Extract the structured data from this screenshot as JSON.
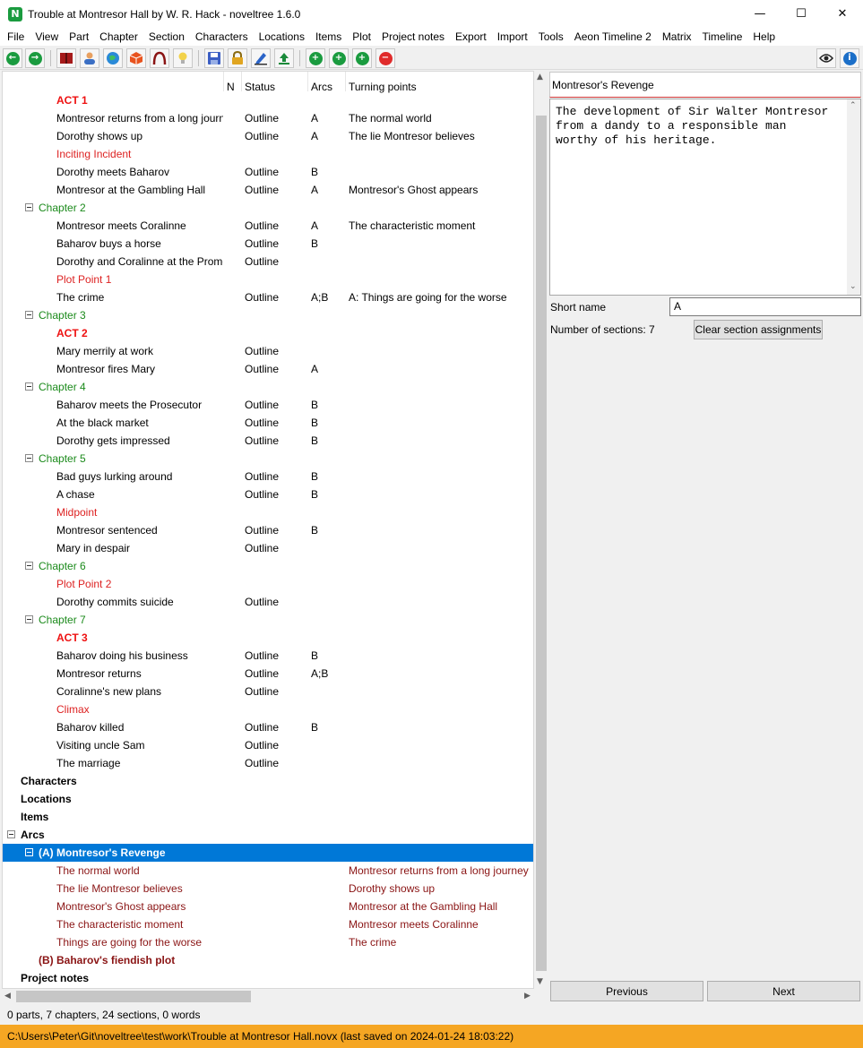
{
  "window": {
    "title": "Trouble at Montresor Hall by W. R. Hack - noveltree 1.6.0",
    "logo_letter": "N",
    "minimize": "—",
    "maximize": "☐",
    "close": "✕"
  },
  "menu": [
    "File",
    "View",
    "Part",
    "Chapter",
    "Section",
    "Characters",
    "Locations",
    "Items",
    "Plot",
    "Project notes",
    "Export",
    "Import",
    "Tools",
    "Aeon Timeline 2",
    "Matrix",
    "Timeline",
    "Help"
  ],
  "toolbar": {
    "icons": [
      "back-icon",
      "forward-icon",
      "book-icon",
      "characters-icon",
      "locations-icon",
      "items-icon",
      "arcs-icon",
      "notes-icon",
      "save-icon",
      "lock-icon",
      "edit-icon",
      "export-icon",
      "add-icon",
      "add-child-icon",
      "add-parent-icon",
      "delete-icon",
      "view-icon",
      "about-icon"
    ],
    "colors": {
      "green": "#1a9b3f",
      "red": "#e02b2b",
      "blue": "#1c6fc8"
    }
  },
  "tree": {
    "columns": {
      "n": "N",
      "status": "Status",
      "arcs": "Arcs",
      "turning_points": "Turning points"
    },
    "rows": [
      {
        "level": 3,
        "type": "stage-major",
        "title": "ACT 1",
        "status": "",
        "arcs": "",
        "tp": ""
      },
      {
        "level": 3,
        "type": "section",
        "title": "Montresor returns from a long journey",
        "status": "Outline",
        "arcs": "A",
        "tp": "The normal world"
      },
      {
        "level": 3,
        "type": "section",
        "title": "Dorothy shows up",
        "status": "Outline",
        "arcs": "A",
        "tp": "The lie Montresor believes"
      },
      {
        "level": 3,
        "type": "stage-minor",
        "title": "Inciting Incident",
        "status": "",
        "arcs": "",
        "tp": ""
      },
      {
        "level": 3,
        "type": "section",
        "title": "Dorothy meets Baharov",
        "status": "Outline",
        "arcs": "B",
        "tp": ""
      },
      {
        "level": 3,
        "type": "section",
        "title": "Montresor at the Gambling Hall",
        "status": "Outline",
        "arcs": "A",
        "tp": "Montresor's Ghost appears"
      },
      {
        "level": 2,
        "type": "chapter",
        "title": "Chapter 2",
        "status": "",
        "arcs": "",
        "tp": ""
      },
      {
        "level": 3,
        "type": "section",
        "title": "Montresor meets Coralinne",
        "status": "Outline",
        "arcs": "A",
        "tp": "The characteristic moment"
      },
      {
        "level": 3,
        "type": "section",
        "title": "Baharov buys a horse",
        "status": "Outline",
        "arcs": "B",
        "tp": ""
      },
      {
        "level": 3,
        "type": "section",
        "title": "Dorothy and Coralinne at the Promenade",
        "status": "Outline",
        "arcs": "",
        "tp": ""
      },
      {
        "level": 3,
        "type": "stage-minor",
        "title": "Plot Point 1",
        "status": "",
        "arcs": "",
        "tp": ""
      },
      {
        "level": 3,
        "type": "section",
        "title": "The crime",
        "status": "Outline",
        "arcs": "A;B",
        "tp": "A: Things are going for the worse"
      },
      {
        "level": 2,
        "type": "chapter",
        "title": "Chapter 3",
        "status": "",
        "arcs": "",
        "tp": ""
      },
      {
        "level": 3,
        "type": "stage-major",
        "title": "ACT 2",
        "status": "",
        "arcs": "",
        "tp": ""
      },
      {
        "level": 3,
        "type": "section",
        "title": "Mary merrily at work",
        "status": "Outline",
        "arcs": "",
        "tp": ""
      },
      {
        "level": 3,
        "type": "section",
        "title": "Montresor fires Mary",
        "status": "Outline",
        "arcs": "A",
        "tp": ""
      },
      {
        "level": 2,
        "type": "chapter",
        "title": "Chapter 4",
        "status": "",
        "arcs": "",
        "tp": ""
      },
      {
        "level": 3,
        "type": "section",
        "title": "Baharov meets the Prosecutor",
        "status": "Outline",
        "arcs": "B",
        "tp": ""
      },
      {
        "level": 3,
        "type": "section",
        "title": "At the black market",
        "status": "Outline",
        "arcs": "B",
        "tp": ""
      },
      {
        "level": 3,
        "type": "section",
        "title": "Dorothy gets impressed",
        "status": "Outline",
        "arcs": "B",
        "tp": ""
      },
      {
        "level": 2,
        "type": "chapter",
        "title": "Chapter 5",
        "status": "",
        "arcs": "",
        "tp": ""
      },
      {
        "level": 3,
        "type": "section",
        "title": "Bad guys lurking around",
        "status": "Outline",
        "arcs": "B",
        "tp": ""
      },
      {
        "level": 3,
        "type": "section",
        "title": "A chase",
        "status": "Outline",
        "arcs": "B",
        "tp": ""
      },
      {
        "level": 3,
        "type": "stage-minor",
        "title": "Midpoint",
        "status": "",
        "arcs": "",
        "tp": ""
      },
      {
        "level": 3,
        "type": "section",
        "title": "Montresor sentenced",
        "status": "Outline",
        "arcs": "B",
        "tp": ""
      },
      {
        "level": 3,
        "type": "section",
        "title": "Mary in despair",
        "status": "Outline",
        "arcs": "",
        "tp": ""
      },
      {
        "level": 2,
        "type": "chapter",
        "title": "Chapter 6",
        "status": "",
        "arcs": "",
        "tp": ""
      },
      {
        "level": 3,
        "type": "stage-minor",
        "title": "Plot Point 2",
        "status": "",
        "arcs": "",
        "tp": ""
      },
      {
        "level": 3,
        "type": "section",
        "title": "Dorothy commits suicide",
        "status": "Outline",
        "arcs": "",
        "tp": ""
      },
      {
        "level": 2,
        "type": "chapter",
        "title": "Chapter 7",
        "status": "",
        "arcs": "",
        "tp": ""
      },
      {
        "level": 3,
        "type": "stage-major",
        "title": "ACT 3",
        "status": "",
        "arcs": "",
        "tp": ""
      },
      {
        "level": 3,
        "type": "section",
        "title": "Baharov doing his business",
        "status": "Outline",
        "arcs": "B",
        "tp": ""
      },
      {
        "level": 3,
        "type": "section",
        "title": "Montresor returns",
        "status": "Outline",
        "arcs": "A;B",
        "tp": ""
      },
      {
        "level": 3,
        "type": "section",
        "title": "Coralinne's new plans",
        "status": "Outline",
        "arcs": "",
        "tp": ""
      },
      {
        "level": 3,
        "type": "stage-minor",
        "title": "Climax",
        "status": "",
        "arcs": "",
        "tp": ""
      },
      {
        "level": 3,
        "type": "section",
        "title": "Baharov killed",
        "status": "Outline",
        "arcs": "B",
        "tp": ""
      },
      {
        "level": 3,
        "type": "section",
        "title": "Visiting uncle Sam",
        "status": "Outline",
        "arcs": "",
        "tp": ""
      },
      {
        "level": 3,
        "type": "section",
        "title": "The marriage",
        "status": "Outline",
        "arcs": "",
        "tp": ""
      },
      {
        "level": 1,
        "type": "root",
        "title": "Characters",
        "status": "",
        "arcs": "",
        "tp": ""
      },
      {
        "level": 1,
        "type": "root",
        "title": "Locations",
        "status": "",
        "arcs": "",
        "tp": ""
      },
      {
        "level": 1,
        "type": "root",
        "title": "Items",
        "status": "",
        "arcs": "",
        "tp": ""
      },
      {
        "level": 1,
        "type": "root-expanded",
        "title": "Arcs",
        "status": "",
        "arcs": "",
        "tp": ""
      },
      {
        "level": 2,
        "type": "arc-selected",
        "title": "(A) Montresor's Revenge",
        "status": "",
        "arcs": "",
        "tp": ""
      },
      {
        "level": 3,
        "type": "arc-item",
        "title": "The normal world",
        "status": "",
        "arcs": "",
        "tp": "Montresor returns from a long journey"
      },
      {
        "level": 3,
        "type": "arc-item",
        "title": "The lie Montresor believes",
        "status": "",
        "arcs": "",
        "tp": "Dorothy shows up"
      },
      {
        "level": 3,
        "type": "arc-item",
        "title": "Montresor's Ghost appears",
        "status": "",
        "arcs": "",
        "tp": "Montresor at the Gambling Hall"
      },
      {
        "level": 3,
        "type": "arc-item",
        "title": "The characteristic moment",
        "status": "",
        "arcs": "",
        "tp": "Montresor meets Coralinne"
      },
      {
        "level": 3,
        "type": "arc-item",
        "title": "Things are going for the worse",
        "status": "",
        "arcs": "",
        "tp": "The crime"
      },
      {
        "level": 2,
        "type": "arc",
        "title": "(B) Baharov's fiendish plot",
        "status": "",
        "arcs": "",
        "tp": ""
      },
      {
        "level": 1,
        "type": "root",
        "title": "Project notes",
        "status": "",
        "arcs": "",
        "tp": ""
      }
    ]
  },
  "properties": {
    "title": "Montresor's Revenge",
    "description": "The development of Sir Walter Montresor\nfrom a dandy to a responsible man\nworthy of his heritage.",
    "short_name_label": "Short name",
    "short_name_value": "A",
    "sections_label": "Number of sections: 7",
    "clear_button": "Clear section assignments",
    "previous_button": "Previous",
    "next_button": "Next"
  },
  "status": {
    "summary": "0 parts, 7 chapters, 24 sections, 0 words",
    "path": "C:\\Users\\Peter\\Git\\noveltree\\test\\work\\Trouble at Montresor Hall.novx (last saved on 2024-01-24 18:03:22)"
  }
}
